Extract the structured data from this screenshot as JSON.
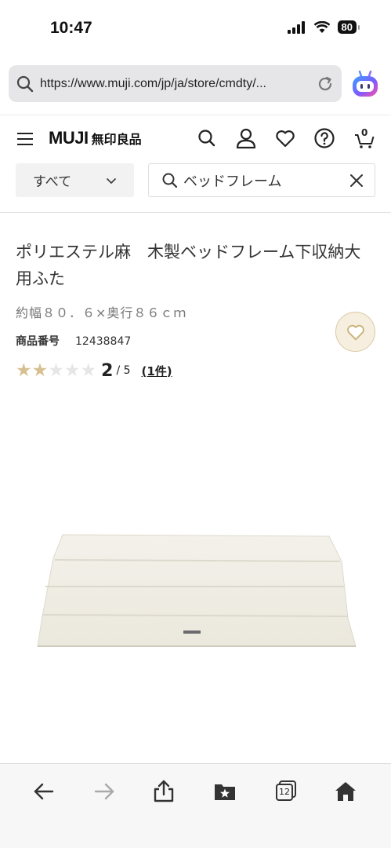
{
  "status_bar": {
    "time": "10:47",
    "battery": "80"
  },
  "browser": {
    "url": "https://www.muji.com/jp/ja/store/cmdty/..."
  },
  "header": {
    "logo": "MUJI",
    "logo_jp": "無印良品",
    "cart_count": "0"
  },
  "search": {
    "category": "すべて",
    "query": "ベッドフレーム"
  },
  "product": {
    "title": "ポリエステル麻　木製ベッドフレーム下収納大用ふた",
    "size": "約幅８０．６×奥行８６ｃｍ",
    "code_label": "商品番号",
    "code": "12438847",
    "rating": 2,
    "rating_max": 5,
    "score": "2",
    "score_suffix": "/ 5",
    "review_count": "(1件)"
  },
  "toolbar": {
    "tabs_count": "12"
  },
  "colors": {
    "accent": "#d7c08f",
    "fav_bg": "#f6efdf"
  },
  "icons": [
    "search-icon",
    "reload-icon",
    "assistant-icon",
    "menu-icon",
    "user-icon",
    "heart-icon",
    "help-icon",
    "cart-icon",
    "close-icon",
    "back-icon",
    "forward-icon",
    "share-icon",
    "bookmarks-icon",
    "tabs-icon",
    "home-icon"
  ]
}
